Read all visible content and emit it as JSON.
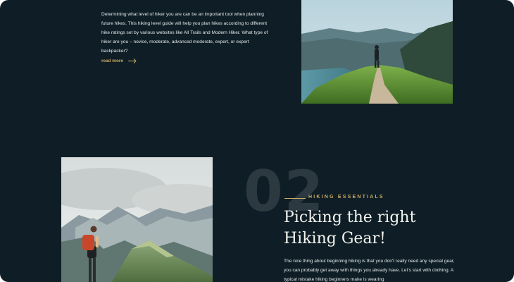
{
  "intro": {
    "text": "Determining what level of hiker you are can be an important tool when planning future hikes. This hiking level guide will help you plan hikes according to different hike ratings set by various websites like All Trails and Modern Hiker. What type of hiker are you – novice, moderate, advanced moderate, expert, or expert backpacker?",
    "read_more_label": "read more",
    "read_more_icon": "arrow-right-icon"
  },
  "section": {
    "number": "02",
    "eyebrow": "HIKING ESSENTIALS",
    "headline_line1": "Picking the right",
    "headline_line2": "Hiking Gear!",
    "body": "The nice thing about beginning hiking is that you don't really need any special gear, you can probably get away with things you already have. Let's start with clothing. A typical mistake hiking beginners make is wearing"
  },
  "colors": {
    "background": "#0f1e26",
    "accent": "#c9a961",
    "text": "#e3e8ea",
    "headline": "#f3f3ef"
  }
}
